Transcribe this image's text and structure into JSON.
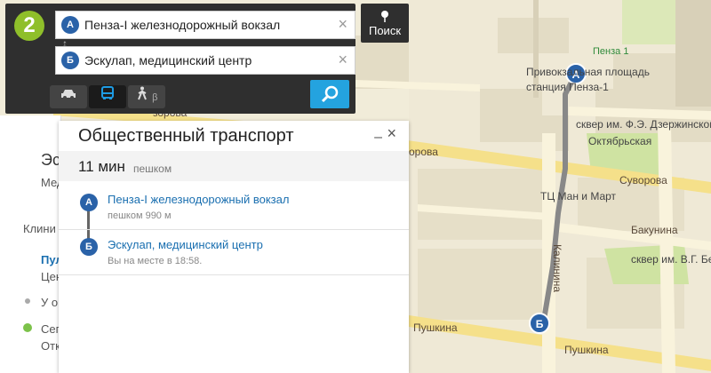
{
  "logo": "2",
  "route_form": {
    "from_marker": "А",
    "from_value": "Пенза-I железнодорожный вокзал",
    "to_marker": "Б",
    "to_value": "Эскулап, медицинский центр",
    "clear_symbol": "×",
    "modes": [
      {
        "name": "car",
        "icon": "car-icon"
      },
      {
        "name": "public-transport",
        "icon": "bus-icon"
      },
      {
        "name": "walking",
        "icon": "walking-person-icon",
        "badge": "β"
      }
    ],
    "go_icon": "search-icon"
  },
  "search_button": {
    "label": "Поиск",
    "icon": "map-pin-icon"
  },
  "route_panel": {
    "title": "Общественный транспорт",
    "minimize_symbol": "–",
    "close_symbol": "×",
    "duration": "11 мин",
    "mode": "пешком",
    "stops": [
      {
        "marker": "А",
        "name": "Пенза-I железнодорожный вокзал",
        "detail": "пешком 990 м"
      },
      {
        "marker": "Б",
        "name": "Эскулап, медицинский центр",
        "detail": "Вы на месте в 18:58."
      }
    ]
  },
  "left_panel": {
    "items": [
      "Эску",
      "Мед",
      "Клини",
      "Пул",
      "Цен",
      "У о",
      "Сег",
      "Отк"
    ]
  },
  "map": {
    "labels": {
      "station_square": "Привокзальная площадь",
      "station_stop": "станция Пенза-1",
      "penza1": "Пенза 1",
      "square1": "сквер им. Ф.Э. Дзержинского",
      "oktyabrskaya": "Октябрьская",
      "suvorova_right": "Суворова",
      "suvorova_left": "орова",
      "suvorova_mid": "Суворова",
      "zorova": "зорова",
      "tc": "ТЦ Ман и Март",
      "bakunina": "Бакунина",
      "square2": "сквер им. В.Г. Бели",
      "pushkina1": "Пушкина",
      "pushkina2": "Пушкина",
      "kalinin": "Калинина"
    },
    "markers": {
      "start": "А",
      "end": "Б"
    },
    "colors": {
      "route": "#888888",
      "marker": "#2a62a8",
      "park": "#cfe3a2",
      "road_yellow": "#f5e08a"
    }
  }
}
